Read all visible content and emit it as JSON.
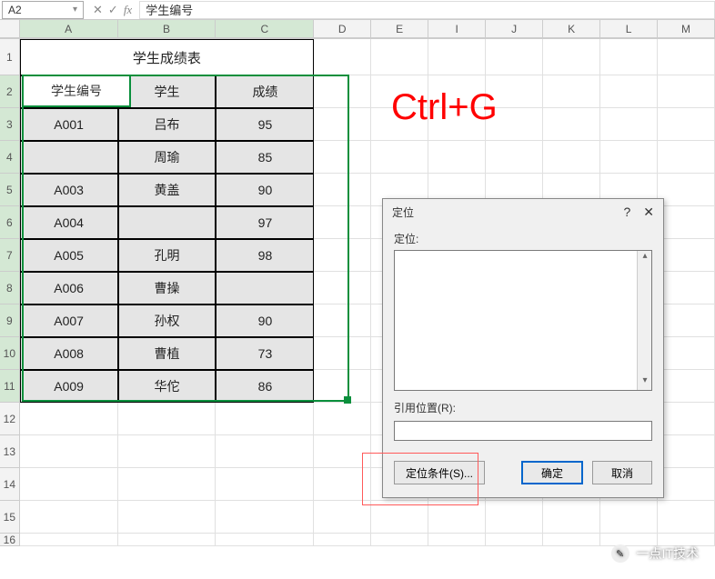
{
  "name_box": "A2",
  "formula_bar": "学生编号",
  "columns": [
    "A",
    "B",
    "C",
    "D",
    "E",
    "I",
    "J",
    "K",
    "L",
    "M"
  ],
  "rows": [
    "1",
    "2",
    "3",
    "4",
    "5",
    "6",
    "7",
    "8",
    "9",
    "10",
    "11",
    "12",
    "13",
    "14",
    "15",
    "16"
  ],
  "table": {
    "title": "学生成绩表",
    "headers": [
      "学生编号",
      "学生",
      "成绩"
    ],
    "data": [
      [
        "A001",
        "吕布",
        "95"
      ],
      [
        "",
        "周瑜",
        "85"
      ],
      [
        "A003",
        "黄盖",
        "90"
      ],
      [
        "A004",
        "",
        "97"
      ],
      [
        "A005",
        "孔明",
        "98"
      ],
      [
        "A006",
        "曹操",
        ""
      ],
      [
        "A007",
        "孙权",
        "90"
      ],
      [
        "A008",
        "曹植",
        "73"
      ],
      [
        "A009",
        "华佗",
        "86"
      ]
    ]
  },
  "annotation": "Ctrl+G",
  "dialog": {
    "title": "定位",
    "list_label": "定位:",
    "ref_label": "引用位置(R):",
    "ref_value": "",
    "btn_special": "定位条件(S)...",
    "btn_ok": "确定",
    "btn_cancel": "取消"
  },
  "watermark": "一点IT技术",
  "active_cell_display": "学生编号"
}
